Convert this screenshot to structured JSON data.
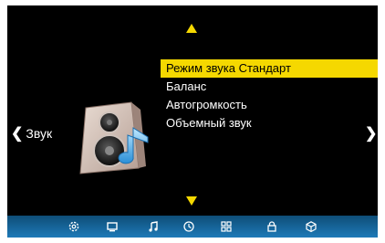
{
  "nav": {
    "left_label": "Звук"
  },
  "menu": {
    "items": [
      {
        "label": "Режим звука Стандарт",
        "selected": true
      },
      {
        "label": "Баланс",
        "selected": false
      },
      {
        "label": "Автогромкость",
        "selected": false
      },
      {
        "label": "Объемный звук",
        "selected": false
      }
    ]
  },
  "icons": {
    "category": "speaker-with-music-note-icon",
    "bottom_bar": [
      "settings-gear-icon",
      "monitor-icon",
      "music-note-icon",
      "clock-icon",
      "grid-icon",
      "lock-icon",
      "cube-icon"
    ]
  },
  "colors": {
    "highlight": "#f5d800",
    "background": "#000000",
    "bar_top": "#0e4d77",
    "bar_bottom": "#1e7ab8"
  }
}
